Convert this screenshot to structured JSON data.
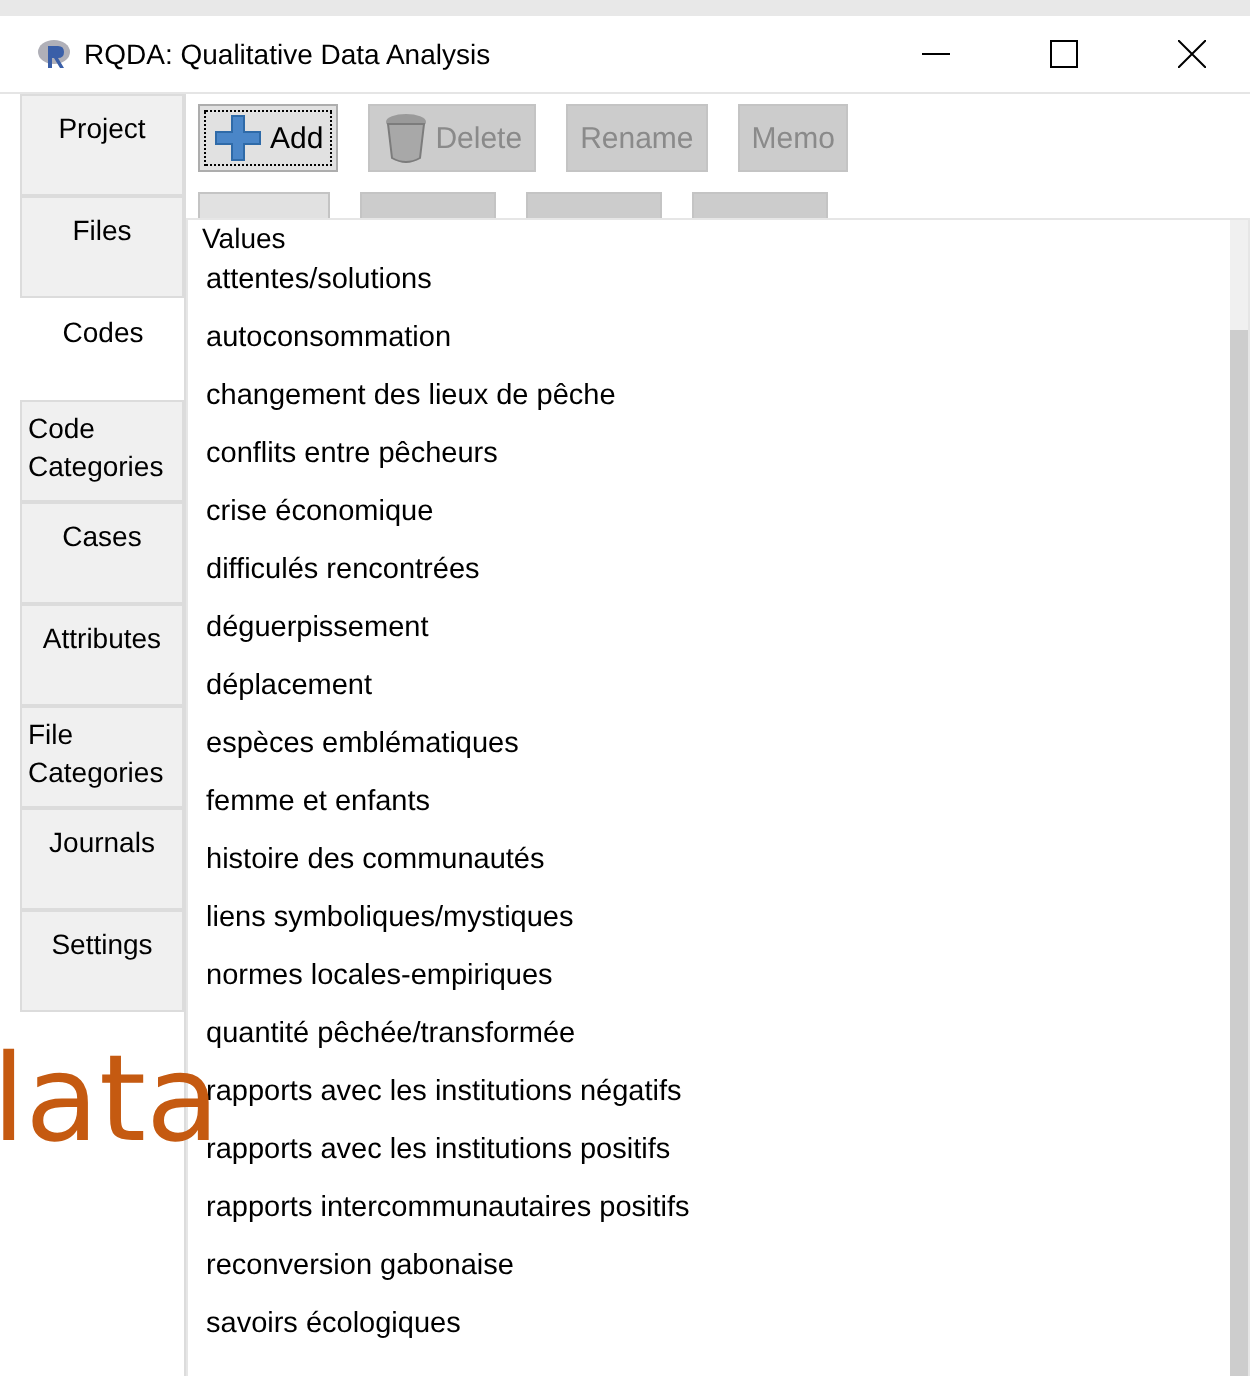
{
  "window": {
    "title": "RQDA: Qualitative Data Analysis"
  },
  "tabs": [
    {
      "label": "Project",
      "selected": false
    },
    {
      "label": "Files",
      "selected": false
    },
    {
      "label": "Codes",
      "selected": true
    },
    {
      "label": "Code Categories",
      "selected": false
    },
    {
      "label": "Cases",
      "selected": false
    },
    {
      "label": "Attributes",
      "selected": false
    },
    {
      "label": "File Categories",
      "selected": false
    },
    {
      "label": "Journals",
      "selected": false
    },
    {
      "label": "Settings",
      "selected": false
    }
  ],
  "toolbar": [
    {
      "label": "Add",
      "kind": "add",
      "disabled": false
    },
    {
      "label": "Delete",
      "kind": "delete",
      "disabled": true
    },
    {
      "label": "Rename",
      "disabled": true
    },
    {
      "label": "Memo",
      "disabled": true
    }
  ],
  "second_toolbar": [
    {
      "disabled": false
    },
    {
      "disabled": true
    },
    {
      "disabled": true
    },
    {
      "disabled": true
    }
  ],
  "popup": {
    "header": "Values",
    "items": [
      "attentes/solutions",
      "autoconsommation",
      "changement des lieux de pêche",
      "conflits entre pêcheurs",
      "crise économique",
      "difficulés rencontrées",
      "déguerpissement",
      "déplacement",
      "espèces emblématiques",
      "femme et enfants",
      "histoire des communautés",
      "liens symboliques/mystiques",
      "normes locales-empiriques",
      "quantité pêchée/transformée",
      "rapports avec les institutions négatifs",
      "rapports avec les institutions positifs",
      "rapports intercommunautaires positifs",
      "reconversion gabonaise",
      "savoirs écologiques"
    ]
  },
  "overlay_text": "lata"
}
